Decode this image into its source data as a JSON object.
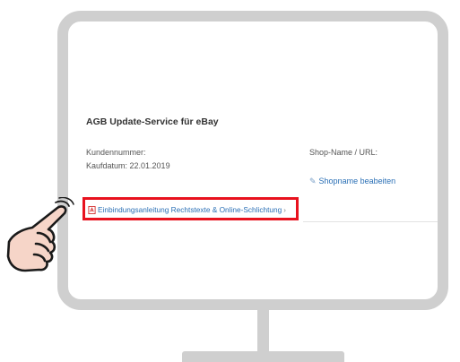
{
  "product_title": "AGB Update-Service für eBay",
  "customer_number_label": "Kundennummer:",
  "purchase_date_text": "Kaufdatum: 22.01.2019",
  "shop_label": "Shop-Name / URL:",
  "edit_shop_link": "Shopname beabeiten",
  "integration_guide_link": "Einbindungsanleitung Rechtstexte & Online-Schlichtung",
  "colors": {
    "monitor_frame": "#cfcfcf",
    "highlight": "#e8121e",
    "link": "#2a6fb5",
    "pdf_icon": "#d32f2f",
    "hand_skin": "#f6d5c8"
  },
  "icons": {
    "pdf": "pdf-icon",
    "edit": "pencil-icon",
    "pointer": "pointing-hand-icon"
  }
}
